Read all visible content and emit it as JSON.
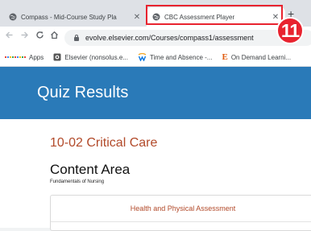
{
  "browser": {
    "tabs": [
      {
        "label": "Compass - Mid-Course Study Pla",
        "close": "✕",
        "favicon": "globe-icon",
        "active": false
      },
      {
        "label": "CBC Assessment Player",
        "close": "✕",
        "favicon": "globe-icon",
        "active": true
      }
    ],
    "new_tab": "+",
    "url": "evolve.elsevier.com/Courses/compass1/assessment",
    "bookmarks": [
      {
        "label": "Apps",
        "icon": "apps-grid-icon"
      },
      {
        "label": "Elsevier (nonsolus.e...",
        "icon": "elsevier-favicon"
      },
      {
        "label": "Time and Absence -...",
        "icon": "workday-icon"
      },
      {
        "label": "On Demand Learni...",
        "icon": "e-logo-icon"
      }
    ]
  },
  "annotation": {
    "badge_number": "11",
    "color": "#e8232f"
  },
  "page": {
    "header_title": "Quiz Results",
    "section_title": "10-02 Critical Care",
    "content_area_label": "Content Area",
    "content_area_value": "Fundamentals of Nursing",
    "panel_header": "Health and Physical Assessment"
  },
  "colors": {
    "header_blue": "#2a7ab8",
    "title_rust": "#b24a2a"
  }
}
